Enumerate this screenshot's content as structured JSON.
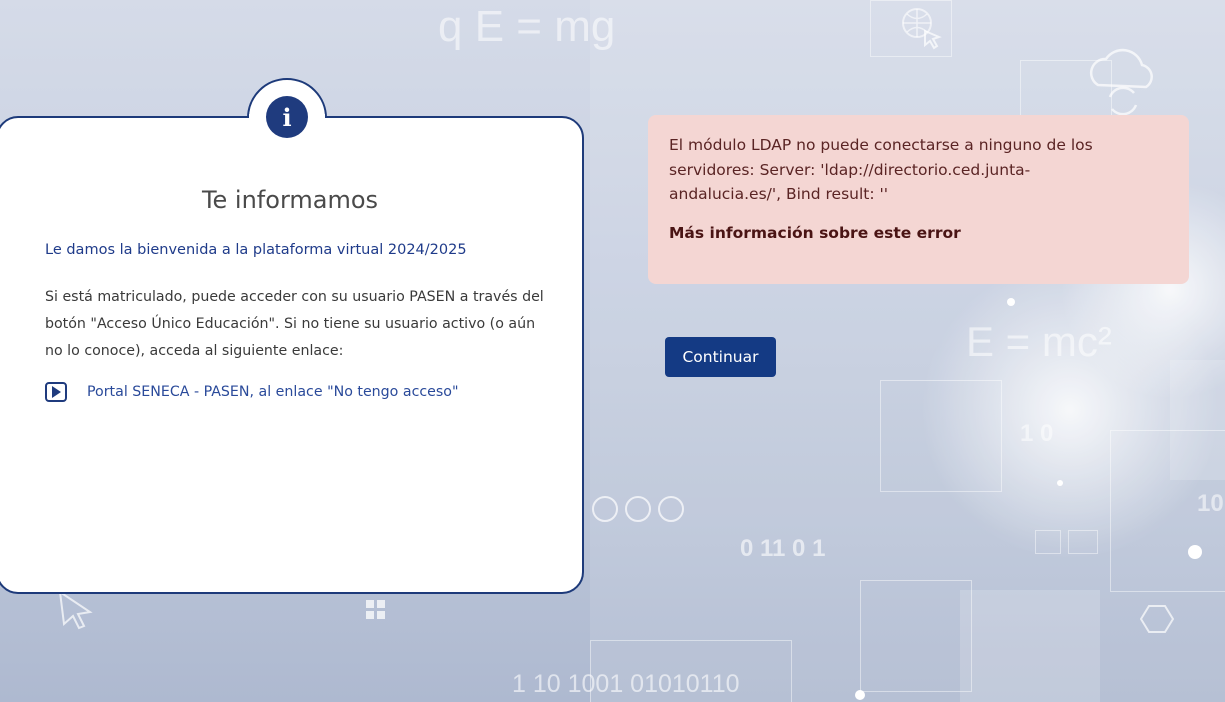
{
  "background": {
    "formulas": [
      "q E = mg",
      "E =  mc²"
    ],
    "binary": [
      "1 10 1001 01010110",
      "0   11  0 1",
      "1  0",
      "10"
    ]
  },
  "info_card": {
    "icon": "info-icon",
    "title": "Te informamos",
    "welcome": "Le damos la bienvenida a la plataforma virtual 2024/2025",
    "body": "Si está matriculado, puede acceder con su usuario PASEN a través del botón \"Acceso Único Educación\". Si no tiene su usuario activo (o aún no lo conoce), acceda al siguiente enlace:",
    "link_icon": "play-icon",
    "link_label": "Portal SENECA - PASEN, al enlace \"No tengo acceso\""
  },
  "error": {
    "message": "El módulo LDAP no puede conectarse a ninguno de los servidores: Server: 'ldap://directorio.ced.junta-andalucia.es/', Bind result: ''",
    "more_link": "Más información sobre este error"
  },
  "continue_label": "Continuar",
  "colors": {
    "primary": "#143a84",
    "card_border": "#1d3a7a",
    "error_bg": "#f4d6d3",
    "error_text": "#5a2424"
  }
}
